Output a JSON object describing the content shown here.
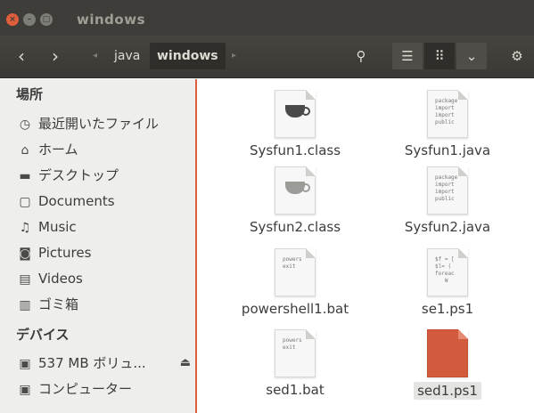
{
  "window": {
    "title": "windows",
    "close_glyph": "×",
    "min_glyph": "–",
    "max_glyph": "□"
  },
  "toolbar": {
    "back_glyph": "‹",
    "forward_glyph": "›",
    "crumb_left_arrow": "◂",
    "crumb_right_arrow": "▸",
    "breadcrumbs": [
      "java",
      "windows"
    ],
    "search_glyph": "⚲",
    "list_view_glyph": "☰",
    "grid_view_glyph": "⠿",
    "menu_glyph": "⌄",
    "settings_glyph": "⚙"
  },
  "sidebar": {
    "places_header": "場所",
    "places": [
      {
        "label": "最近開いたファイル",
        "icon": "clock-icon",
        "glyph": "◷"
      },
      {
        "label": "ホーム",
        "icon": "home-icon",
        "glyph": "⌂"
      },
      {
        "label": "デスクトップ",
        "icon": "folder-icon",
        "glyph": "▬"
      },
      {
        "label": "Documents",
        "icon": "document-icon",
        "glyph": "▢"
      },
      {
        "label": "Music",
        "icon": "music-icon",
        "glyph": "♫"
      },
      {
        "label": "Pictures",
        "icon": "camera-icon",
        "glyph": "◙"
      },
      {
        "label": "Videos",
        "icon": "film-icon",
        "glyph": "▤"
      },
      {
        "label": "ゴミ箱",
        "icon": "trash-icon",
        "glyph": "▥"
      }
    ],
    "devices_header": "デバイス",
    "devices": [
      {
        "label": "537 MB ボリュ...",
        "icon": "drive-icon",
        "glyph": "▣",
        "eject_glyph": "⏏"
      },
      {
        "label": "コンピューター",
        "icon": "computer-icon",
        "glyph": "▣"
      }
    ]
  },
  "files": [
    {
      "name": "Sysfun1.class",
      "kind": "class",
      "thumb_text": ""
    },
    {
      "name": "Sysfun1.java",
      "kind": "java",
      "thumb_text": "package\nimport\nimport\npublic"
    },
    {
      "name": "Sysfun2.class",
      "kind": "class-light",
      "thumb_text": ""
    },
    {
      "name": "Sysfun2.java",
      "kind": "java",
      "thumb_text": "package\nimport\nimport\npublic"
    },
    {
      "name": "powershell1.bat",
      "kind": "bat",
      "thumb_text": "powers\nexit"
    },
    {
      "name": "se1.ps1",
      "kind": "ps1",
      "thumb_text": "$f = [\n$l= (\nforeac\n   W"
    },
    {
      "name": "sed1.bat",
      "kind": "bat",
      "thumb_text": "powers\nexit"
    },
    {
      "name": "sed1.ps1",
      "kind": "orange",
      "thumb_text": ""
    }
  ],
  "colors": {
    "accent": "#e05e3b",
    "titlebar": "#3e3d39",
    "sidebar_bg": "#eeeeec",
    "selected_file_thumb": "#d35b3d"
  }
}
